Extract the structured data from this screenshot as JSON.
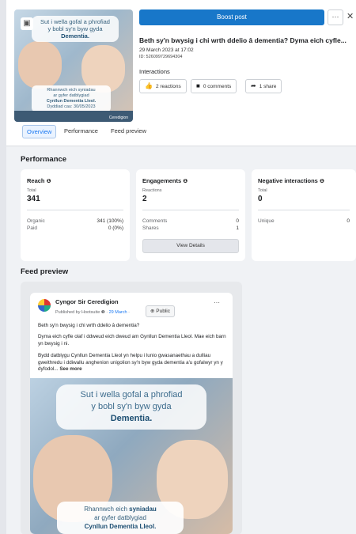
{
  "header": {
    "boost_label": "Boost post",
    "more_label": "···",
    "close_label": "✕",
    "post_title": "Beth sy'n bwysig i chi wrth ddelio â dementia? Dyma eich cyfle...",
    "post_date": "29 March 2023 at 17:02",
    "post_id": "ID: 526099729694304"
  },
  "thumbnail": {
    "line1": "Sut i wella gofal a phrofiad",
    "line2": "y bobl sy'n byw gyda",
    "line3": "Dementia.",
    "cap_line1": "Rhannwch eich syniadau",
    "cap_line2": "ar gyfer datblygiad",
    "cap_line3": "Cynllun Dementia Lleol.",
    "cap_line4": "Dyddiad cau: 30/05/2023",
    "brand": "Ceredigion"
  },
  "interactions": {
    "heading": "Interactions",
    "reactions": "2 reactions",
    "comments": "0 comments",
    "shares": "1 share"
  },
  "tabs": [
    {
      "label": "Overview"
    },
    {
      "label": "Performance"
    },
    {
      "label": "Feed preview"
    }
  ],
  "performance": {
    "heading": "Performance",
    "reach": {
      "title": "Reach",
      "sublabel": "Total",
      "value": "341",
      "rows": [
        {
          "label": "Organic",
          "value": "341 (100%)"
        },
        {
          "label": "Paid",
          "value": "0 (0%)"
        }
      ]
    },
    "engagements": {
      "title": "Engagements",
      "sublabel": "Reactions",
      "value": "2",
      "rows": [
        {
          "label": "Comments",
          "value": "0"
        },
        {
          "label": "Shares",
          "value": "1"
        }
      ],
      "button": "View Details"
    },
    "negative": {
      "title": "Negative interactions",
      "sublabel": "Total",
      "value": "0",
      "rows": [
        {
          "label": "Unique",
          "value": "0"
        }
      ]
    }
  },
  "feed": {
    "heading": "Feed preview",
    "page_name": "Cyngor Sir Ceredigion",
    "published_by": "Published by Hootsuite",
    "date": "29 March",
    "audience": "Public",
    "more": "···",
    "para1": "Beth sy'n bwysig i chi wrth ddelio â dementia?",
    "para2": "Dyma eich cyfle olaf i ddweud eich dweud am Gynllun Dementia Lleol. Mae eich barn yn bwysig i ni.",
    "para3": "Bydd datblygu Cynllun Dementia Lleol yn helpu i lunio gwasanaethau a dulliau gweithredu i ddiwallu anghenion unigolion sy'n byw gyda dementia a'u gofalwyr yn y dyfodol...",
    "see_more": "See more",
    "img_line1": "Sut i wella gofal a phrofiad",
    "img_line2": "y bobl sy'n byw gyda",
    "img_line3": "Dementia.",
    "img_cap1": "Rhannwch eich",
    "img_cap1b": "syniadau",
    "img_cap2": "ar gyfer datblygiad",
    "img_cap3": "Cynllun Dementia Lleol."
  }
}
